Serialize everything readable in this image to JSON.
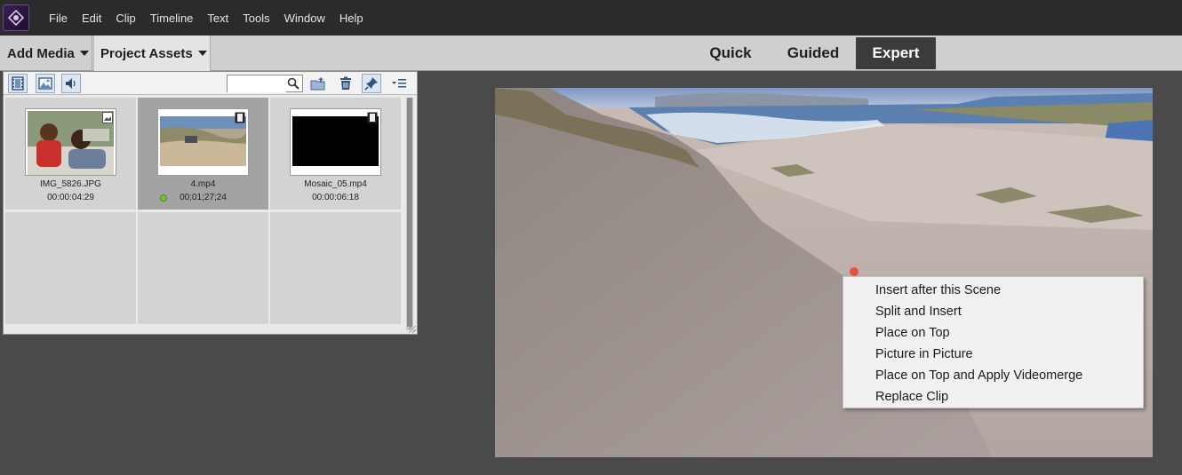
{
  "menu": [
    "File",
    "Edit",
    "Clip",
    "Timeline",
    "Text",
    "Tools",
    "Window",
    "Help"
  ],
  "workspace": {
    "add_media": "Add Media",
    "project_assets": "Project Assets",
    "modes": [
      "Quick",
      "Guided",
      "Expert"
    ],
    "active_mode": "Expert"
  },
  "assets": {
    "search_placeholder": "",
    "items": [
      {
        "name": "IMG_5826.JPG",
        "duration": "00:00:04:29"
      },
      {
        "name": "4.mp4",
        "duration": "00;01;27;24",
        "selected": true
      },
      {
        "name": "Mosaic_05.mp4",
        "duration": "00:00:06:18"
      }
    ]
  },
  "context_menu": [
    "Insert after this Scene",
    "Split and Insert",
    "Place on Top",
    "Picture in Picture",
    "Place on Top and Apply Videomerge",
    "Replace Clip"
  ]
}
